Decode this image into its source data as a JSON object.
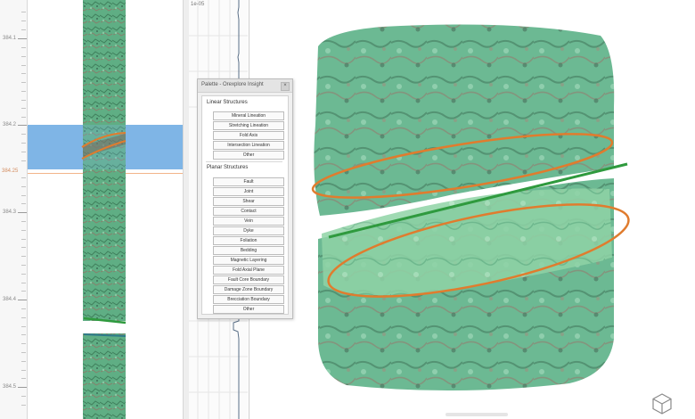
{
  "ruler": {
    "labels": [
      "384.1",
      "384.2",
      "384.25",
      "384.3",
      "384.4",
      "384.5"
    ]
  },
  "log": {
    "scale_label": "1e-05"
  },
  "palette": {
    "title": "Palette - Orexplore Insight",
    "close_glyph": "×",
    "linear_title": "Linear Structures",
    "linear_items": [
      "Mineral Lineation",
      "Stretching Lineation",
      "Fold Axis",
      "Intersection Lineation",
      "Other"
    ],
    "planar_title": "Planar Structures",
    "planar_items": [
      "Fault",
      "Joint",
      "Shear",
      "Contact",
      "Vein",
      "Dyke",
      "Foliation",
      "Bedding",
      "Magnetic Layering",
      "Fold Axial Plane",
      "Fault Core Boundary",
      "Damage Zone Boundary",
      "Brecciation Boundary",
      "Other"
    ]
  },
  "colors": {
    "selection": "#7fb5e6",
    "rock_green": "#4faa7d",
    "fracture_orange": "#e07c2e",
    "fracture_green": "#2f9a3e",
    "marker": "#f2b48a"
  },
  "icons": {
    "view_cube": "cube-icon"
  }
}
